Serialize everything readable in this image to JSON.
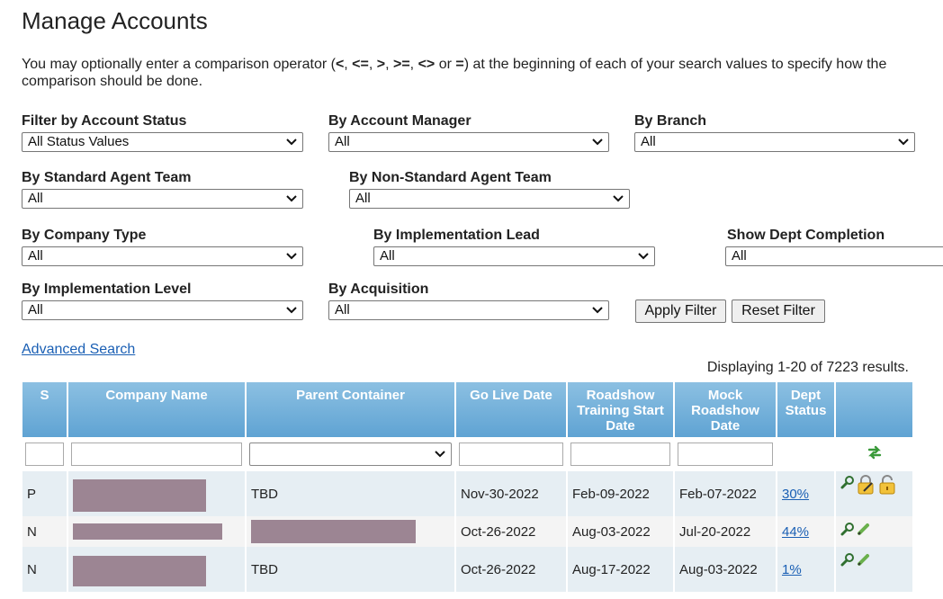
{
  "page_title": "Manage Accounts",
  "intro": {
    "p1": "You may optionally enter a comparison operator (",
    "op1": "<",
    "sep1": ", ",
    "op2": "<=",
    "sep2": ", ",
    "op3": ">",
    "sep3": ", ",
    "op4": ">=",
    "sep4": ", ",
    "op5": "<>",
    "or": " or ",
    "op6": "=",
    "p2": ") at the beginning of each of your search values to specify how the comparison should be done."
  },
  "filters": {
    "account_status": {
      "label": "Filter by Account Status",
      "value": "All Status Values"
    },
    "account_manager": {
      "label": "By Account Manager",
      "value": "All"
    },
    "branch": {
      "label": "By Branch",
      "value": "All"
    },
    "standard_agent_team": {
      "label": "By Standard Agent Team",
      "value": "All"
    },
    "non_standard_agent_team": {
      "label": "By Non-Standard Agent Team",
      "value": "All"
    },
    "company_type": {
      "label": "By Company Type",
      "value": "All"
    },
    "implementation_lead": {
      "label": "By Implementation Lead",
      "value": "All"
    },
    "dept_completion": {
      "label": "Show Dept Completion",
      "value": "All"
    },
    "implementation_level": {
      "label": "By Implementation Level",
      "value": "All"
    },
    "acquisition": {
      "label": "By Acquisition",
      "value": "All"
    }
  },
  "buttons": {
    "apply": "Apply Filter",
    "reset": "Reset Filter"
  },
  "advanced_search": "Advanced Search",
  "results_text": "Displaying 1-20 of 7223 results.",
  "table": {
    "columns": {
      "s": "S",
      "company": "Company Name",
      "parent": "Parent Container",
      "golive": "Go Live Date",
      "roadshow_l1": "Roadshow",
      "roadshow_l2": "Training Start",
      "roadshow_l3": "Date",
      "mock_l1": "Mock",
      "mock_l2": "Roadshow",
      "mock_l3": "Date",
      "dept_l1": "Dept",
      "dept_l2": "Status"
    },
    "rows": [
      {
        "s": "P",
        "parent": "TBD",
        "golive": "Nov-30-2022",
        "roadshow": "Feb-09-2022",
        "mock": "Feb-07-2022",
        "dept": "30%"
      },
      {
        "s": "N",
        "parent": "",
        "golive": "Oct-26-2022",
        "roadshow": "Aug-03-2022",
        "mock": "Jul-20-2022",
        "dept": "44%"
      },
      {
        "s": "N",
        "parent": "TBD",
        "golive": "Oct-26-2022",
        "roadshow": "Aug-17-2022",
        "mock": "Aug-03-2022",
        "dept": "1%"
      }
    ]
  },
  "colors": {
    "header_top": "#8cc0e2",
    "header_bottom": "#5fa3d3",
    "link": "#1a5fb4",
    "redaction": "#9c8593",
    "row_alt": "#e6eef3"
  }
}
